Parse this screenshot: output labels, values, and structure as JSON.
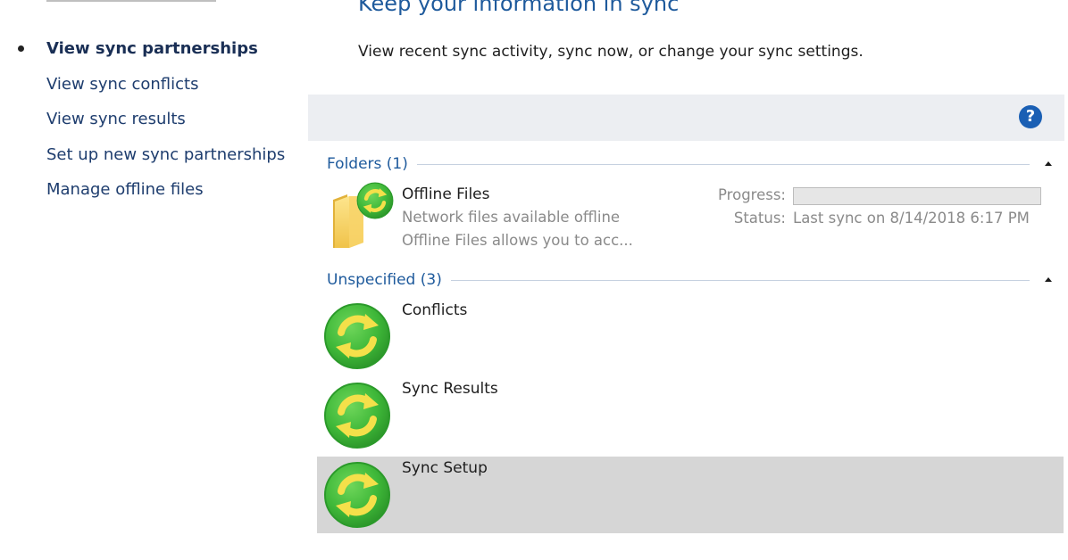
{
  "sidebar": {
    "items": [
      {
        "label": "View sync partnerships",
        "active": true
      },
      {
        "label": "View sync conflicts"
      },
      {
        "label": "View sync results"
      },
      {
        "label": "Set up new sync partnerships"
      },
      {
        "label": "Manage offline files"
      }
    ]
  },
  "main": {
    "title": "Keep your information in sync",
    "subtitle": "View recent sync activity, sync now, or change your sync settings."
  },
  "toolbar": {
    "help_label": "?"
  },
  "groups": [
    {
      "label": "Folders (1)",
      "items": [
        {
          "title": "Offline Files",
          "desc1": "Network files available offline",
          "desc2": "Offline Files allows you to acc...",
          "progress_label": "Progress:",
          "progress": 0,
          "status_label": "Status:",
          "status_value": "Last sync on 8/14/2018 6:17 PM",
          "icon": "folder-sync-icon"
        }
      ]
    },
    {
      "label": "Unspecified (3)",
      "items": [
        {
          "title": "Conflicts",
          "icon": "sync-icon"
        },
        {
          "title": "Sync Results",
          "icon": "sync-icon"
        },
        {
          "title": "Sync Setup",
          "icon": "sync-icon",
          "selected": true
        }
      ]
    }
  ],
  "colors": {
    "accent": "#1e5a9c",
    "sync_green": "#3fb839",
    "sync_arrow": "#f4e04a",
    "selection": "#d6d6d6",
    "toolbar": "#eceef2"
  }
}
